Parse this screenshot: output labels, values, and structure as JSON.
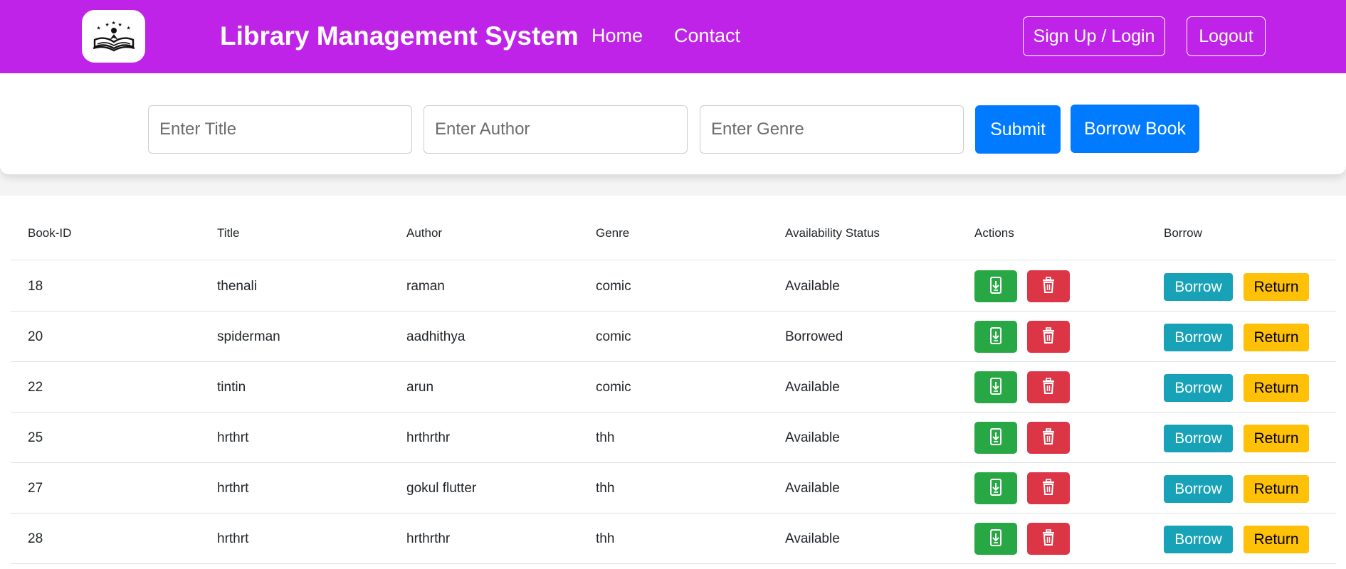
{
  "header": {
    "brand": "Library Management System",
    "nav": {
      "home": "Home",
      "contact": "Contact"
    },
    "signup_login": "Sign Up / Login",
    "logout": "Logout"
  },
  "form": {
    "title_placeholder": "Enter Title",
    "author_placeholder": "Enter Author",
    "genre_placeholder": "Enter Genre",
    "submit": "Submit",
    "borrow_book": "Borrow Book"
  },
  "table": {
    "headers": [
      "Book-ID",
      "Title",
      "Author",
      "Genre",
      "Availability Status",
      "Actions",
      "Borrow"
    ],
    "rows": [
      [
        "18",
        "thenali",
        "raman",
        "comic",
        "Available"
      ],
      [
        "20",
        "spiderman",
        "aadhithya",
        "comic",
        "Borrowed"
      ],
      [
        "22",
        "tintin",
        "arun",
        "comic",
        "Available"
      ],
      [
        "25",
        "hrthrt",
        "hrthrthr",
        "thh",
        "Available"
      ],
      [
        "27",
        "hrthrt",
        "gokul flutter",
        "thh",
        "Available"
      ],
      [
        "28",
        "hrthrt",
        "hrthrthr",
        "thh",
        "Available"
      ]
    ],
    "borrow_label": "Borrow",
    "return_label": "Return"
  },
  "colors": {
    "navbar": "#bf23e8",
    "primary": "#007bff",
    "success": "#28a745",
    "danger": "#dc3545",
    "info": "#17a2b8",
    "warning": "#ffc107"
  },
  "icons": {
    "logo": "open-book-logo-icon",
    "edit": "phone-download-icon",
    "delete": "trash-icon"
  }
}
